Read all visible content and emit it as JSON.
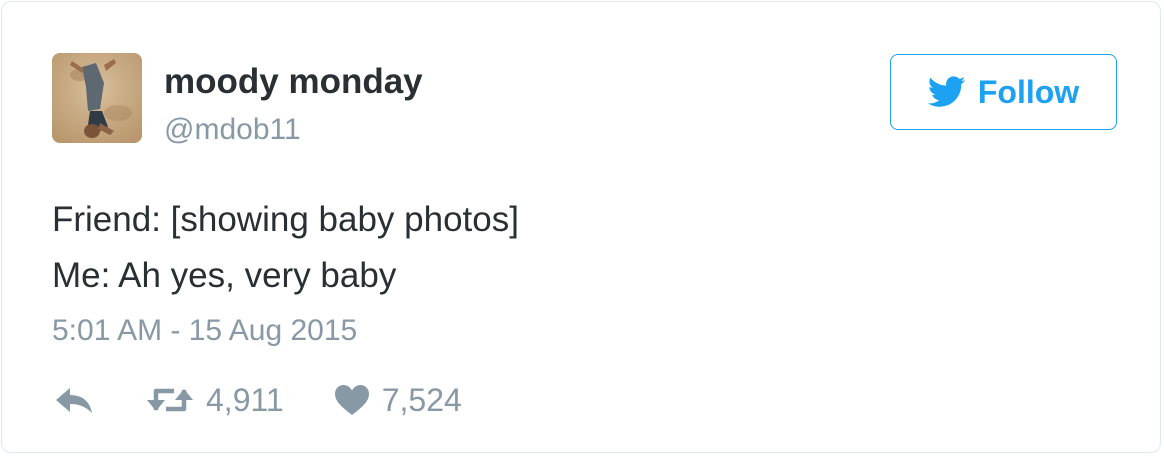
{
  "tweet": {
    "display_name": "moody monday",
    "handle": "@mdob11",
    "text_lines": [
      "Friend: [showing baby photos]",
      "Me: Ah yes, very baby"
    ],
    "timestamp": "5:01 AM - 15 Aug 2015",
    "retweets": "4,911",
    "likes": "7,524"
  },
  "follow_button": {
    "label": "Follow",
    "icon": "twitter-bird-icon"
  },
  "icons": {
    "reply": "reply-icon",
    "retweet": "retweet-icon",
    "like": "heart-icon"
  },
  "colors": {
    "brand_blue": "#1da1f2",
    "text": "#292f33",
    "muted": "#8899a6",
    "border": "#e1e8ed"
  }
}
